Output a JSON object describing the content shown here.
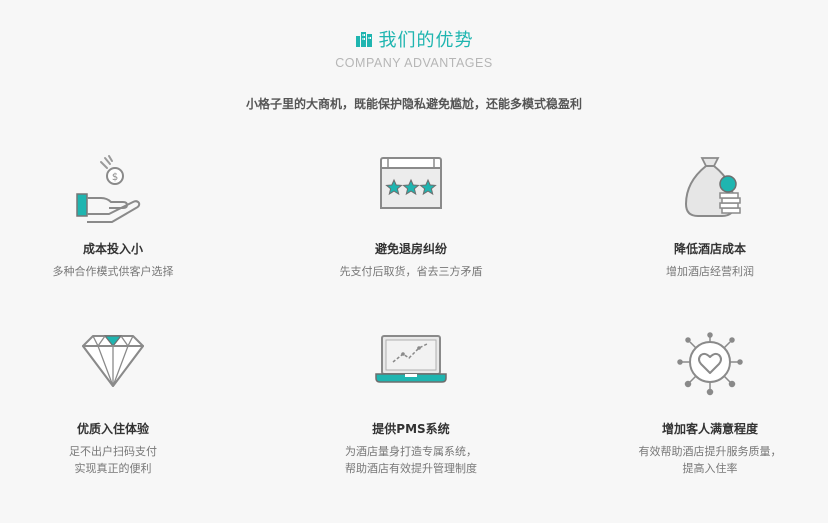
{
  "header": {
    "title": "我们的优势",
    "subtitle": "COMPANY ADVANTAGES",
    "slogan": "小格子里的大商机，既能保护隐私避免尴尬，还能多模式稳盈利"
  },
  "colors": {
    "accent": "#1fb5b0",
    "icon_gray": "#8a8a8a"
  },
  "features": [
    {
      "icon": "hand-coin-icon",
      "title": "成本投入小",
      "desc1": "多种合作模式供客户选择",
      "desc2": ""
    },
    {
      "icon": "stars-card-icon",
      "title": "避免退房纠纷",
      "desc1": "先支付后取货，省去三方矛盾",
      "desc2": ""
    },
    {
      "icon": "money-bag-icon",
      "title": "降低酒店成本",
      "desc1": "增加酒店经营利润",
      "desc2": ""
    },
    {
      "icon": "diamond-icon",
      "title": "优质入住体验",
      "desc1": "足不出户扫码支付",
      "desc2": "实现真正的便利"
    },
    {
      "icon": "laptop-icon",
      "title": "提供PMS系统",
      "desc1": "为酒店量身打造专属系统，",
      "desc2": "帮助酒店有效提升管理制度"
    },
    {
      "icon": "heart-network-icon",
      "title": "增加客人满意程度",
      "desc1": "有效帮助酒店提升服务质量，",
      "desc2": "提高入住率"
    }
  ]
}
